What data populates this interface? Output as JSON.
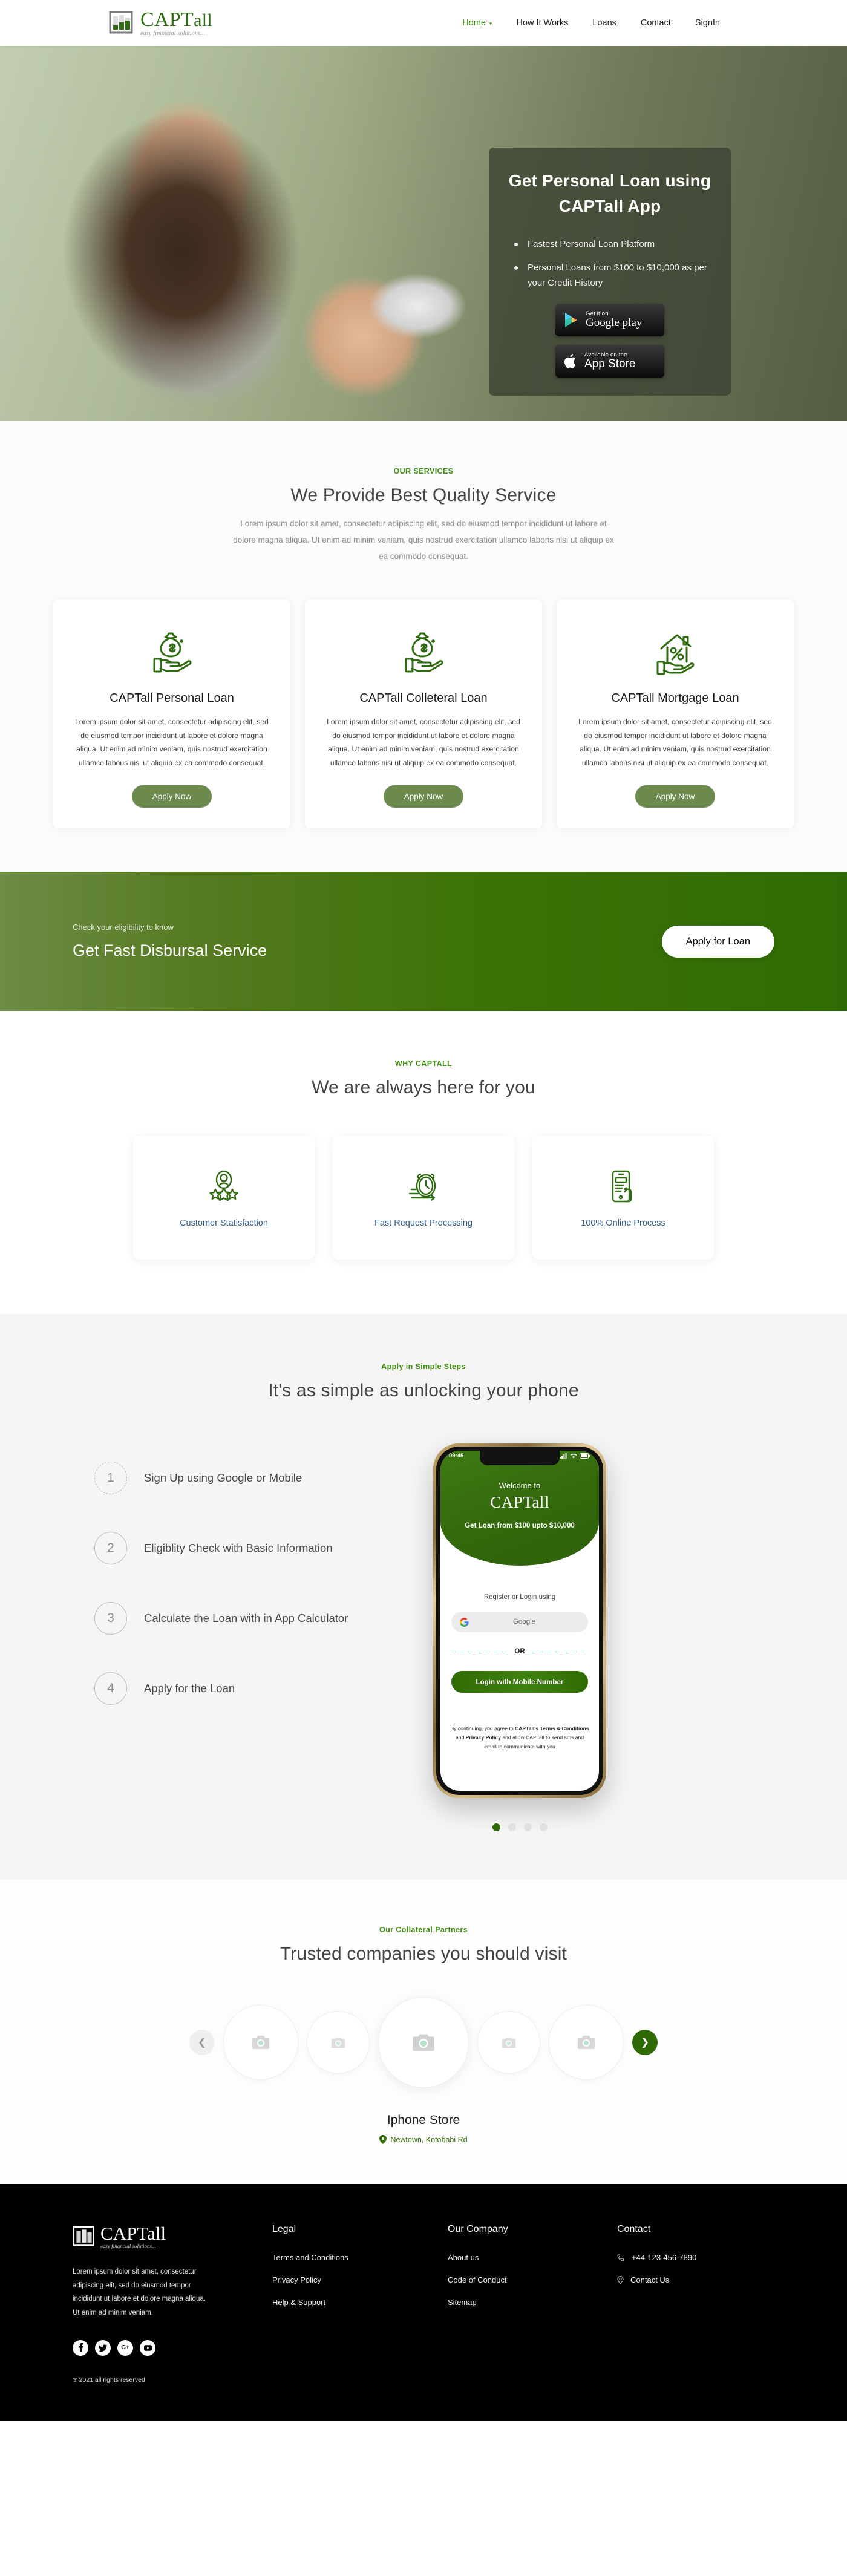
{
  "brand": {
    "name_bold": "CAPT",
    "name_light": "all",
    "tagline": "easy financial solutions..."
  },
  "nav": {
    "items": [
      {
        "label": "Home",
        "active": true,
        "has_caret": true
      },
      {
        "label": "How It Works",
        "active": false,
        "has_caret": false
      },
      {
        "label": "Loans",
        "active": false,
        "has_caret": false
      },
      {
        "label": "Contact",
        "active": false,
        "has_caret": false
      },
      {
        "label": "SignIn",
        "active": false,
        "has_caret": false
      }
    ]
  },
  "hero": {
    "title_line1": "Get Personal Loan using",
    "title_line2": "CAPTall App",
    "bullets": [
      "Fastest Personal Loan Platform",
      "Personal Loans from $100 to $10,000 as per your Credit History"
    ],
    "google_play": {
      "small": "Get it on",
      "big": "Google play"
    },
    "app_store": {
      "small": "Available on the",
      "big": "App Store"
    }
  },
  "services": {
    "eyebrow": "OUR SERVICES",
    "title": "We Provide Best Quality Service",
    "subtitle": "Lorem ipsum dolor sit amet, consectetur adipiscing elit, sed do eiusmod tempor incididunt ut labore et dolore magna aliqua. Ut enim ad minim veniam, quis nostrud exercitation ullamco laboris nisi ut aliquip ex ea commodo consequat.",
    "cards": [
      {
        "icon": "money-bag-in-hand-icon",
        "title": "CAPTall Personal Loan",
        "body": "Lorem ipsum dolor sit amet, consectetur adipiscing elit, sed do eiusmod tempor incididunt ut labore et dolore magna aliqua. Ut enim ad minim veniam, quis nostrud exercitation ullamco laboris nisi ut aliquip ex ea commodo consequat.",
        "button": "Apply Now"
      },
      {
        "icon": "money-bag-in-hand-icon",
        "title": "CAPTall Colleteral Loan",
        "body": "Lorem ipsum dolor sit amet, consectetur adipiscing elit, sed do eiusmod tempor incididunt ut labore et dolore magna aliqua. Ut enim ad minim veniam, quis nostrud exercitation ullamco laboris nisi ut aliquip ex ea commodo consequat.",
        "button": "Apply Now"
      },
      {
        "icon": "house-percent-in-hand-icon",
        "title": "CAPTall Mortgage Loan",
        "body": "Lorem ipsum dolor sit amet, consectetur adipiscing elit, sed do eiusmod tempor incididunt ut labore et dolore magna aliqua. Ut enim ad minim veniam, quis nostrud exercitation ullamco laboris nisi ut aliquip ex ea commodo consequat.",
        "button": "Apply Now"
      }
    ]
  },
  "banner": {
    "eyebrow": "Check your eligibility to know",
    "title": "Get Fast Disbursal Service",
    "button": "Apply for Loan"
  },
  "why": {
    "eyebrow": "WHY CAPTALL",
    "title": "We are always here for you",
    "cards": [
      {
        "icon": "user-stars-icon",
        "label": "Customer Statisfaction"
      },
      {
        "icon": "fast-clock-icon",
        "label": "Fast Request Processing"
      },
      {
        "icon": "mobile-hand-icon",
        "label": "100% Online Process"
      }
    ]
  },
  "steps": {
    "eyebrow": "Apply in Simple Steps",
    "title": "It's as simple as unlocking your phone",
    "items": [
      {
        "num": "1",
        "text": "Sign Up using Google or Mobile"
      },
      {
        "num": "2",
        "text": "Eligiblity Check with Basic Information"
      },
      {
        "num": "3",
        "text": "Calculate the Loan with in App Calculator"
      },
      {
        "num": "4",
        "text": "Apply for the Loan"
      }
    ],
    "phone": {
      "status_time": "09:45",
      "welcome": "Welcome to",
      "app_name": "CAPTall",
      "loan_line": "Get Loan from $100 upto $10,000",
      "register_label": "Register or Login using",
      "google_button": "Google",
      "or": "OR",
      "mobile_button": "Login with Mobile Number",
      "terms_1": "By continuing, you agree to ",
      "terms_bold1": "CAPTall's Terms & Conditions",
      "terms_2": " and ",
      "terms_bold2": "Privacy Policy",
      "terms_3": " and allow CAPTall to send sms and email to communicate with you"
    },
    "dots": 4,
    "active_dot": 0
  },
  "partners": {
    "eyebrow": "Our Collateral Partners",
    "title": "Trusted companies you should visit",
    "prev_icon": "chevron-left-icon",
    "next_icon": "chevron-right-icon",
    "slides": 5,
    "active_name": "Iphone Store",
    "active_location": "Newtown, Kotobabi Rd"
  },
  "footer": {
    "description": "Lorem ipsum dolor sit amet, consectetur adipiscing elit, sed do eiusmod tempor incididunt ut labore et dolore magna aliqua. Ut enim ad minim veniam.",
    "socials": [
      {
        "icon": "facebook-icon",
        "glyph": "f"
      },
      {
        "icon": "twitter-icon",
        "glyph": "ᴠ"
      },
      {
        "icon": "google-plus-icon",
        "glyph": "G+"
      },
      {
        "icon": "youtube-icon",
        "glyph": "▶"
      }
    ],
    "copyright": "® 2021 all rights reserved",
    "legal": {
      "heading": "Legal",
      "links": [
        "Terms and Conditions",
        "Privacy Policy",
        "Help & Support"
      ]
    },
    "company": {
      "heading": "Our Company",
      "links": [
        "About us",
        "Code of Conduct",
        "Sitemap"
      ]
    },
    "contact": {
      "heading": "Contact",
      "phone": "+44-123-456-7890",
      "phone_icon": "phone-icon",
      "contact_link": "Contact Us",
      "location_icon": "location-pin-icon"
    }
  },
  "colors": {
    "brand_green": "#2f6b04",
    "accent_green": "#3f8c10",
    "card_button": "#6c8a4e",
    "footer_bg": "#000000"
  }
}
